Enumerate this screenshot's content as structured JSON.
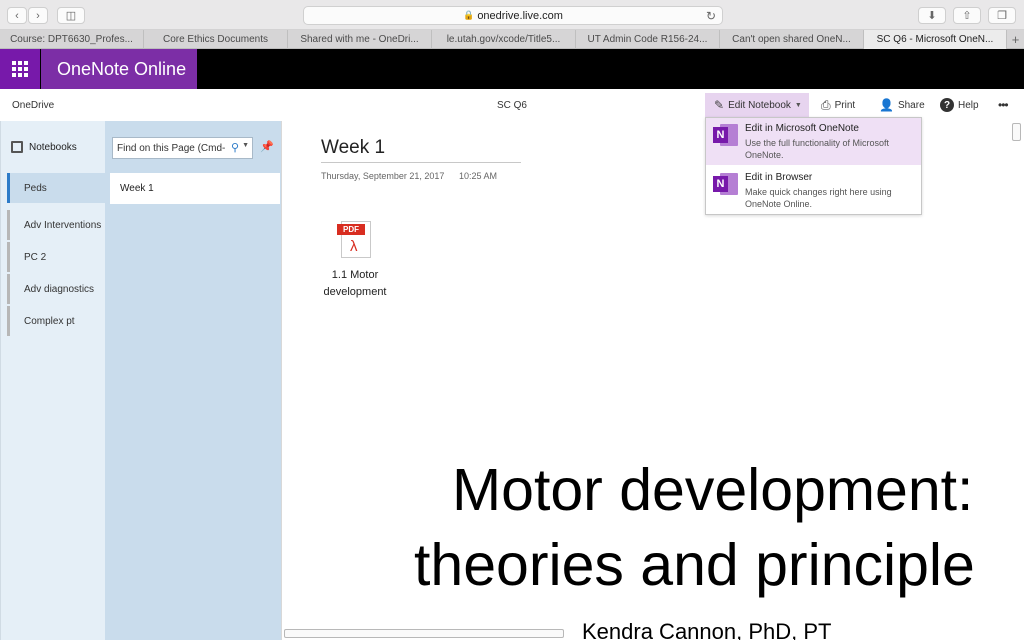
{
  "browser": {
    "url": "onedrive.live.com",
    "tabs": [
      {
        "label": "Course: DPT6630_Profes..."
      },
      {
        "label": "Core Ethics Documents"
      },
      {
        "label": "Shared with me - OneDri..."
      },
      {
        "label": "le.utah.gov/xcode/Title5..."
      },
      {
        "label": "UT Admin Code R156-24..."
      },
      {
        "label": "Can't open shared OneN..."
      },
      {
        "label": "SC Q6 - Microsoft OneN..."
      }
    ]
  },
  "app": {
    "name": "OneNote Online",
    "accent": "#7719aa"
  },
  "commandbar": {
    "breadcrumb": "OneDrive",
    "notebook_title": "SC Q6",
    "edit_notebook": "Edit Notebook",
    "print": "Print",
    "share": "Share",
    "help": "Help",
    "more": "•••"
  },
  "edit_menu": {
    "items": [
      {
        "title": "Edit in Microsoft OneNote",
        "desc": "Use the full functionality of Microsoft OneNote."
      },
      {
        "title": "Edit in Browser",
        "desc": "Make quick changes right here using OneNote Online."
      }
    ]
  },
  "notebooks": {
    "header": "Notebooks",
    "sections": [
      "Peds",
      "Adv Interventions",
      "PC 2",
      "Adv diagnostics",
      "Complex pt"
    ]
  },
  "pages": {
    "search_placeholder": "Find on this Page (Cmd-",
    "items": [
      "Week 1"
    ]
  },
  "page": {
    "title": "Week 1",
    "date": "Thursday, September 21, 2017",
    "time": "10:25 AM",
    "attachment": {
      "tag": "PDF",
      "line1": "1.1 Motor",
      "line2": "development"
    },
    "slide_lines": [
      "Motor development:",
      "theories and principle",
      "Kendra Cannon, PhD, PT"
    ]
  }
}
